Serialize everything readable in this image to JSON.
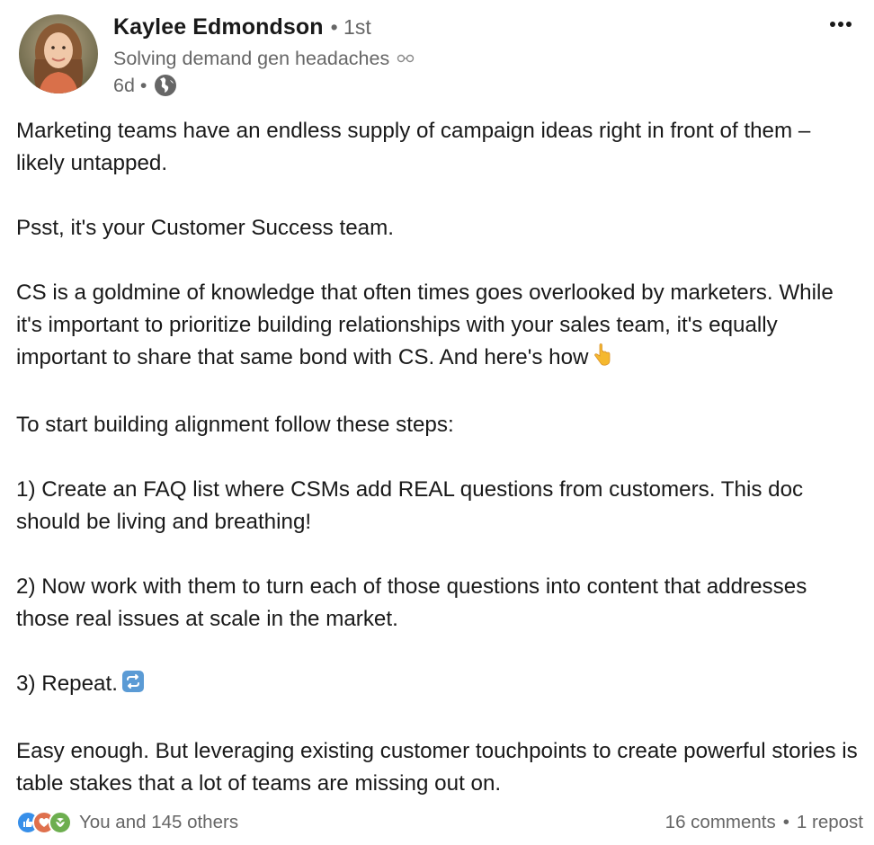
{
  "author": {
    "name": "Kaylee Edmondson",
    "degree": "• 1st",
    "headline": "Solving demand gen headaches",
    "time": "6d",
    "dot": "•"
  },
  "post": {
    "paragraphs": [
      "Marketing teams have an endless supply of campaign ideas right in front of them – likely untapped.",
      "Psst, it's your Customer Success team.",
      "CS is a goldmine of knowledge that often times goes overlooked by marketers. While it's important to prioritize building relationships with your sales team, it's equally important to share that same bond with CS. And here's how",
      "To start building alignment follow these steps:",
      "1) Create an FAQ list where CSMs add REAL questions from customers. This doc should be living and breathing!",
      "2) Now work with them to turn each of those questions into content that addresses those real issues at scale in the market.",
      "3) Repeat.",
      "Easy enough. But leveraging existing customer touchpoints to create powerful stories is table stakes that a lot of teams are missing out on."
    ],
    "emoji_pointing_down": "👇",
    "emoji_repeat": "🔁"
  },
  "footer": {
    "reactions_text": "You and 145 others",
    "comments": "16 comments",
    "separator": "•",
    "reposts": "1 repost"
  },
  "icons": {
    "more": "more-horizontal-icon",
    "globe": "globe-icon",
    "verify": "hearing-icon",
    "like": "like-reaction-icon",
    "love": "love-reaction-icon",
    "support": "support-reaction-icon"
  },
  "colors": {
    "text": "#191919",
    "muted": "#666666",
    "like": "#378fe9",
    "love": "#df704d",
    "support": "#6dae4f"
  }
}
